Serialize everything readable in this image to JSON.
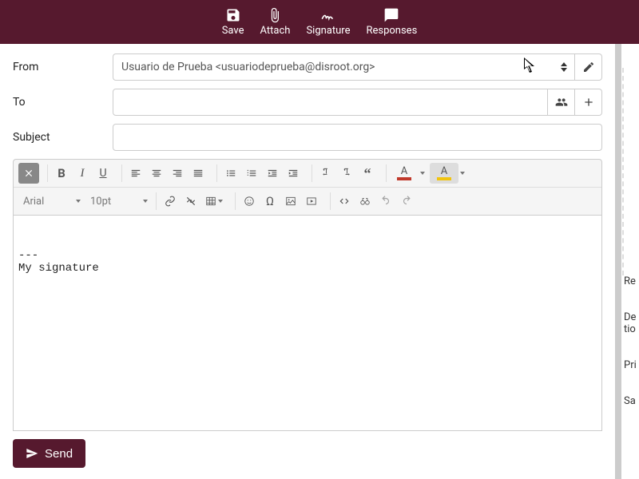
{
  "toolbar": {
    "save": "Save",
    "attach": "Attach",
    "signature": "Signature",
    "responses": "Responses"
  },
  "fields": {
    "from_label": "From",
    "from_value": "Usuario de Prueba <usuariodeprueba@disroot.org>",
    "to_label": "To",
    "to_value": "",
    "subject_label": "Subject",
    "subject_value": ""
  },
  "editor": {
    "font_family": "Arial",
    "font_size": "10pt",
    "body": "\n\n---\nMy signature"
  },
  "right": {
    "item1": "Re",
    "item2a": "De",
    "item2b": "tio",
    "item3": "Pri",
    "item4": "Sa"
  },
  "send": {
    "label": "Send"
  }
}
